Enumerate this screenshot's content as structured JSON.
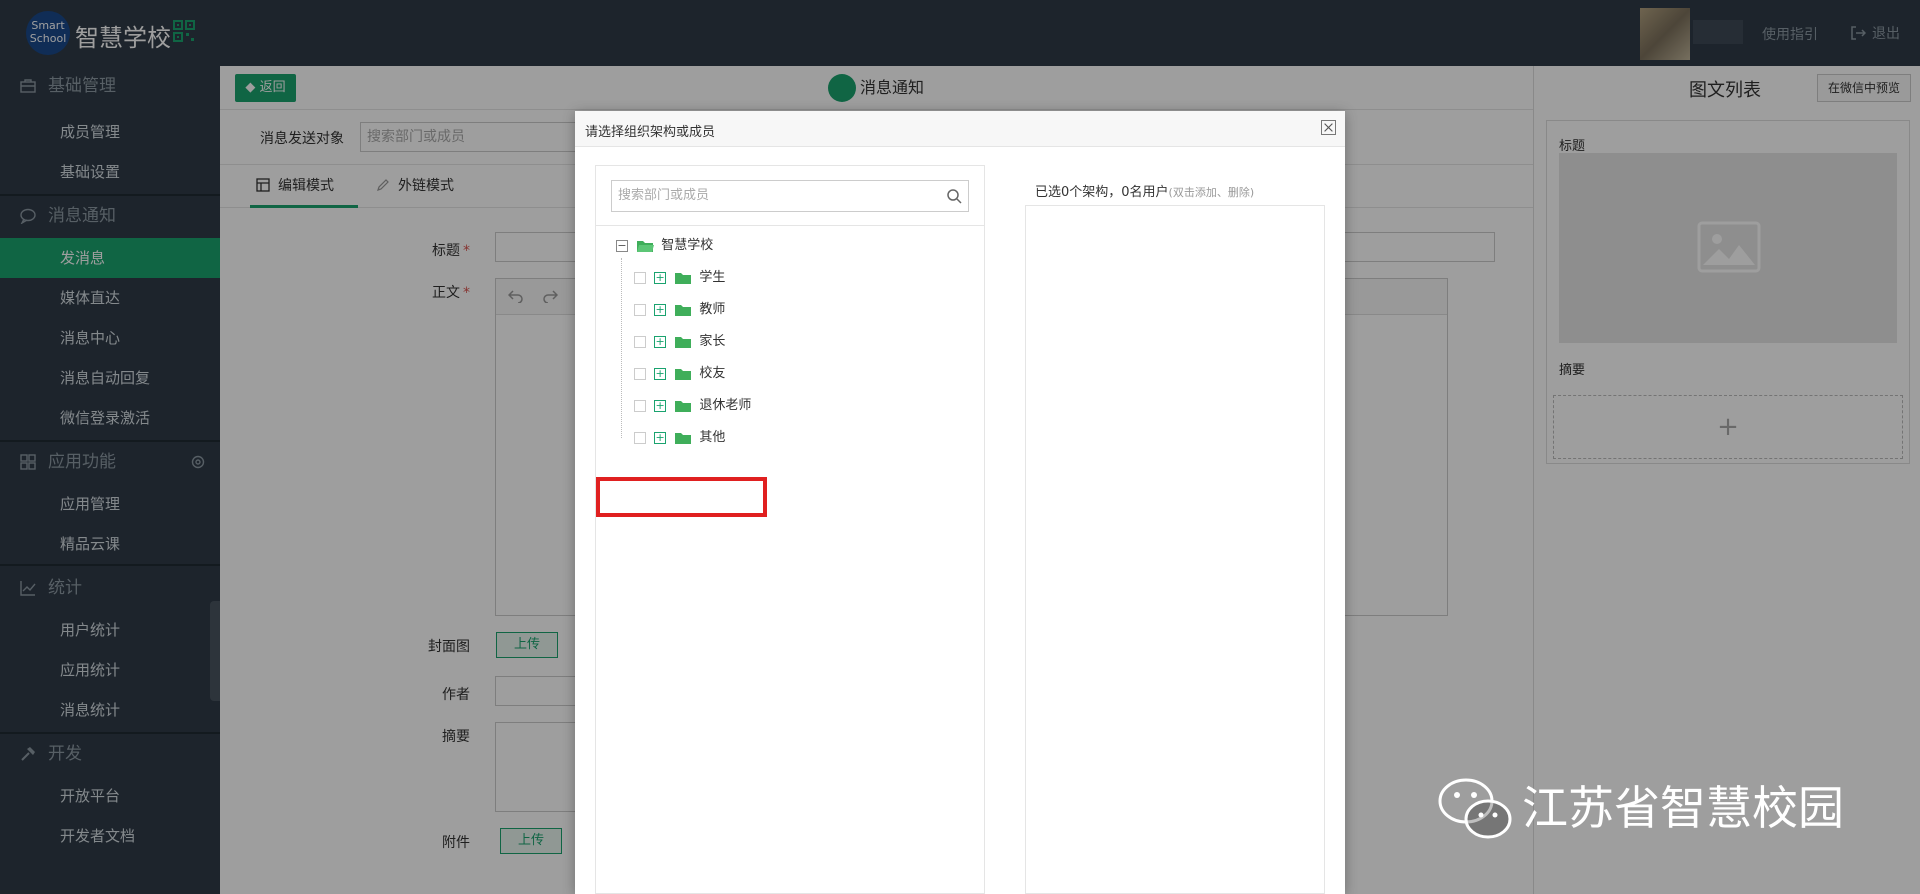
{
  "topbar": {
    "logo_text": "Smart School",
    "brand": "智慧学校",
    "help": "使用指引",
    "logout": "退出"
  },
  "sidebar": {
    "groups": [
      {
        "label": "基础管理",
        "icon": "briefcase-icon",
        "items": [
          "成员管理",
          "基础设置"
        ]
      },
      {
        "label": "消息通知",
        "icon": "chat-icon",
        "items": [
          "发消息",
          "媒体直达",
          "消息中心",
          "消息自动回复",
          "微信登录激活"
        ]
      },
      {
        "label": "应用功能",
        "icon": "grid-icon",
        "items": [
          "应用管理",
          "精品云课"
        ]
      },
      {
        "label": "统计",
        "icon": "chart-icon",
        "items": [
          "用户统计",
          "应用统计",
          "消息统计"
        ]
      },
      {
        "label": "开发",
        "icon": "hammer-icon",
        "items": [
          "开放平台",
          "开发者文档"
        ]
      }
    ],
    "active_item": "发消息"
  },
  "main": {
    "back": "返回",
    "title": "消息通知",
    "target_label": "消息发送对象",
    "target_placeholder": "搜索部门或成员",
    "tabs": [
      "编辑模式",
      "外链模式"
    ],
    "form": {
      "title_label": "标题",
      "body_label": "正文",
      "cover_label": "封面图",
      "author_label": "作者",
      "summary_label": "摘要",
      "attach_label": "附件",
      "upload": "上传"
    }
  },
  "right_panel": {
    "title": "图文列表",
    "preview_btn": "在微信中预览",
    "card_title": "标题",
    "card_summary": "摘要",
    "add": "+"
  },
  "modal": {
    "title": "请选择组织架构或成员",
    "search_placeholder": "搜索部门或成员",
    "tree_root": "智慧学校",
    "tree_nodes": [
      "学生",
      "教师",
      "家长",
      "校友",
      "退休老师",
      "其他"
    ],
    "selected_count": "已选0个架构，0名用户",
    "selected_hint": "(双击添加、删除)"
  },
  "watermark": "江苏省智慧校园",
  "colors": {
    "accent": "#1aa36f",
    "dark_bg": "#2f3b47",
    "highlight": "#e02020"
  }
}
